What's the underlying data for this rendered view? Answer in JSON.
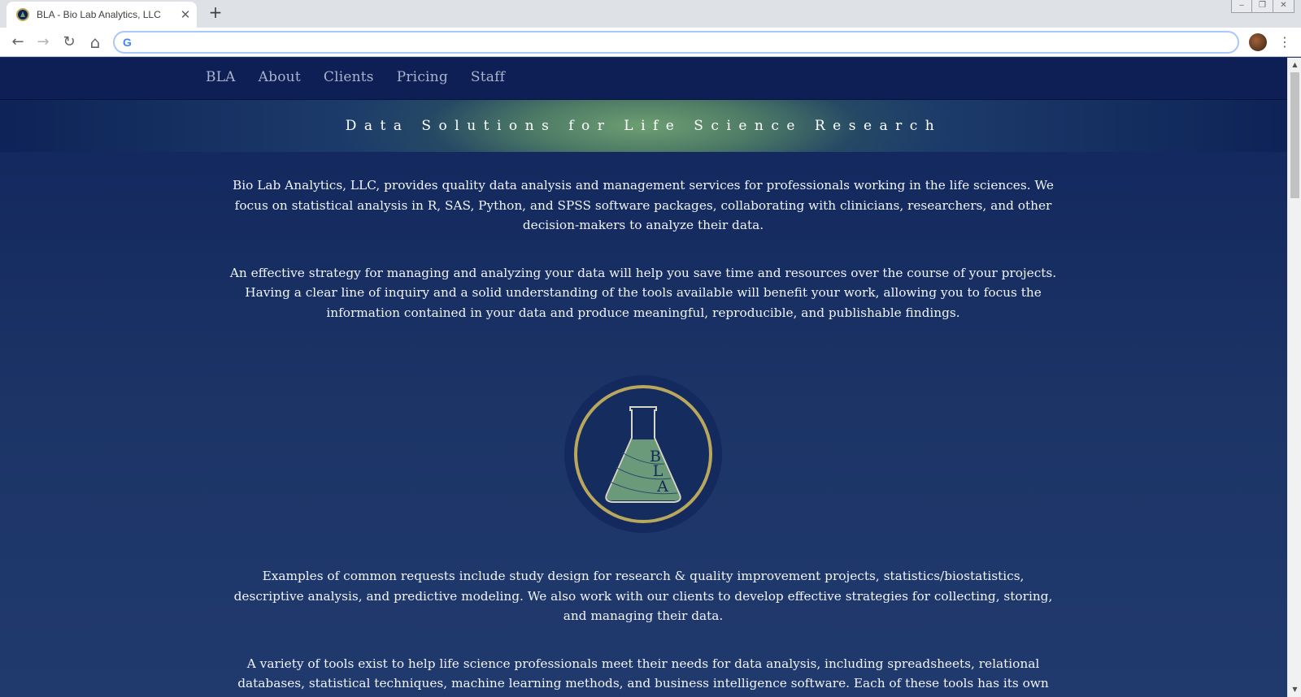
{
  "browser": {
    "tab_title": "BLA - Bio Lab Analytics, LLC",
    "tab_close": "✕",
    "new_tab": "+",
    "address_value": "",
    "back": "←",
    "forward": "→",
    "reload": "↻",
    "home": "⌂",
    "menu": "⋮",
    "window_controls": [
      "‒",
      "❐",
      "✕"
    ],
    "google_icon": "G"
  },
  "site": {
    "nav": {
      "items": [
        "BLA",
        "About",
        "Clients",
        "Pricing",
        "Staff"
      ]
    },
    "banner_title": "Data Solutions for Life Science Research",
    "paragraphs": [
      "Bio Lab Analytics, LLC, provides quality data analysis and management services for professionals working in the life sciences. We focus on statistical analysis in R, SAS, Python, and SPSS software packages, collaborating with clinicians, researchers, and other decision-makers to analyze their data.",
      "An effective strategy for managing and analyzing your data will help you save time and resources over the course of your projects. Having a clear line of inquiry and a solid understanding of the tools available will benefit your work, allowing you to focus the information contained in your data and produce meaningful, reproducible, and publishable findings.",
      "Examples of common requests include study design for research & quality improvement projects, statistics/biostatistics, descriptive analysis, and predictive modeling. We also work with our clients to develop effective strategies for collecting, storing, and managing their data.",
      "A variety of tools exist to help life science professionals meet their needs for data analysis, including spreadsheets, relational databases, statistical techniques, machine learning methods, and business intelligence software. Each of these tools has its own"
    ],
    "logo": {
      "letters": [
        "B",
        "L",
        "A"
      ]
    }
  },
  "colors": {
    "nav_bg": "#0d1f55",
    "page_bg": "#1c3164",
    "banner_green": "#6d9f72",
    "logo_gold": "#b9a75c",
    "flask_green": "#6a9a7a"
  }
}
